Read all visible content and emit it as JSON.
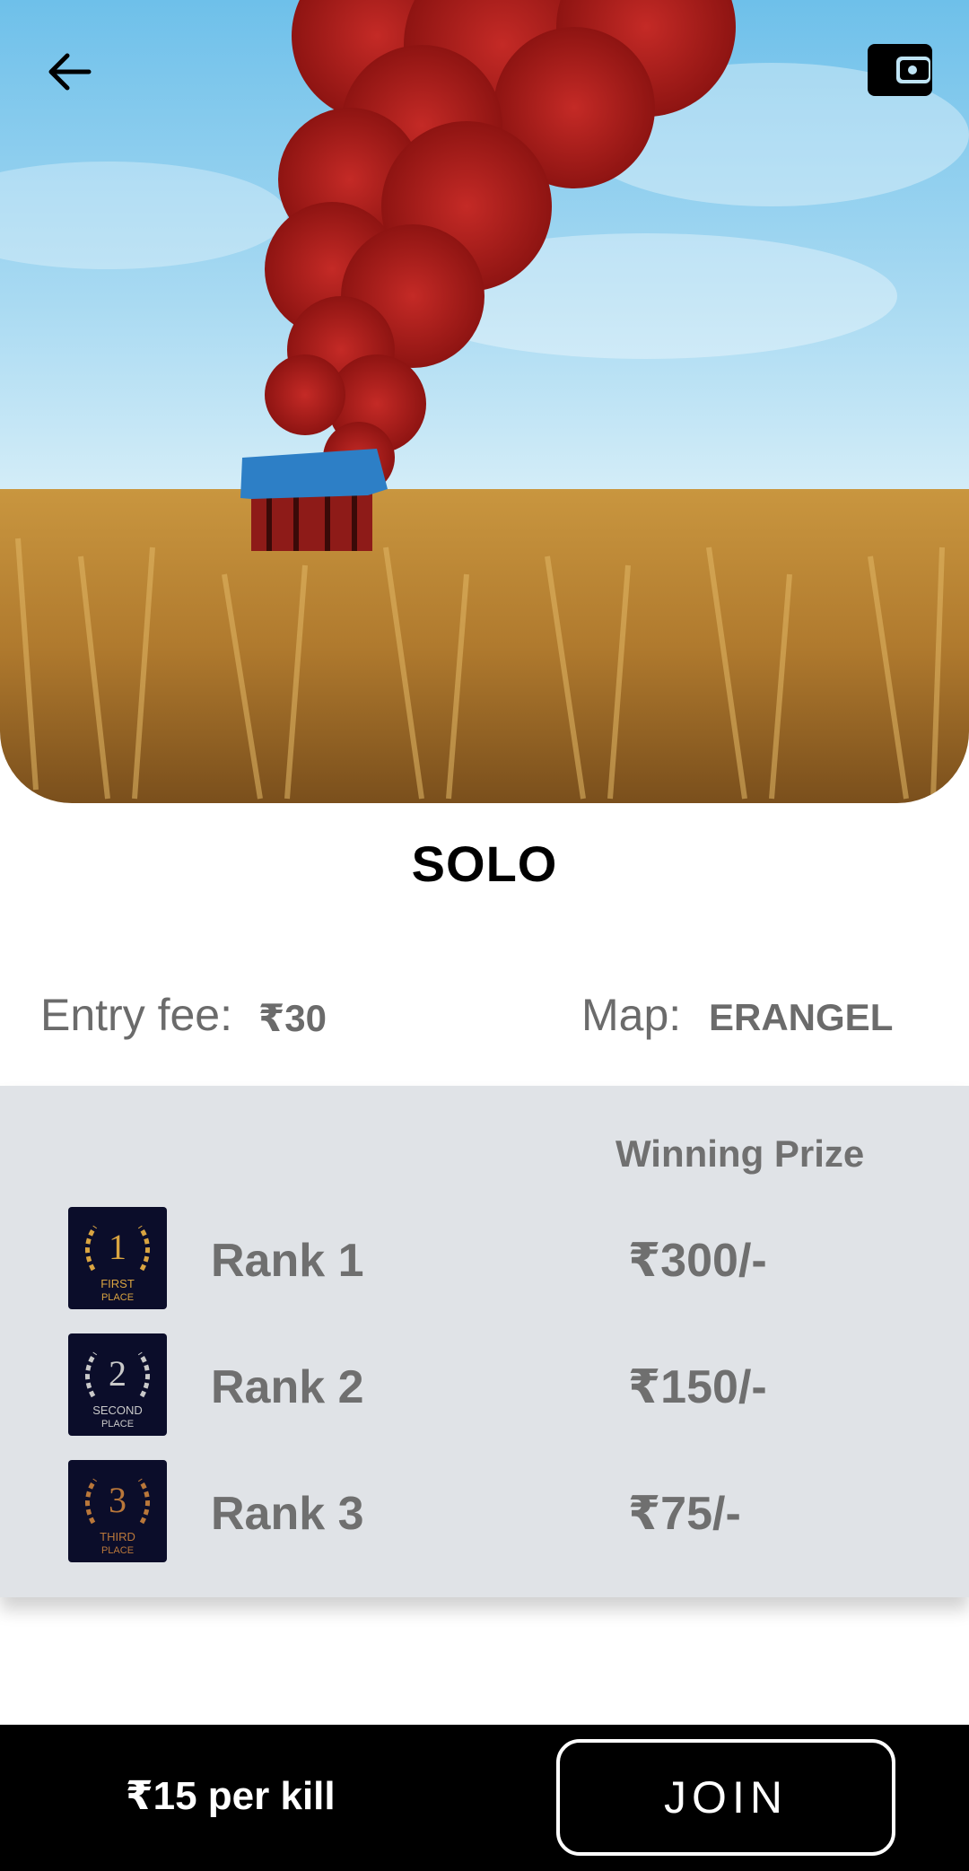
{
  "header": {
    "back_icon": "arrow-left-icon",
    "wallet_icon": "wallet-icon"
  },
  "match": {
    "title": "SOLO",
    "entry_fee_label": "Entry fee:",
    "entry_fee_value": "₹30",
    "map_label": "Map:",
    "map_value": "ERANGEL"
  },
  "prizes": {
    "header": "Winning Prize",
    "ranks": [
      {
        "label": "Rank 1",
        "prize": "₹300/-",
        "badge_number": "1",
        "badge_text_1": "FIRST",
        "badge_text_2": "PLACE",
        "badge_color": "#d9a441"
      },
      {
        "label": "Rank 2",
        "prize": "₹150/-",
        "badge_number": "2",
        "badge_text_1": "SECOND",
        "badge_text_2": "PLACE",
        "badge_color": "#c9c9c9"
      },
      {
        "label": "Rank 3",
        "prize": "₹75/-",
        "badge_number": "3",
        "badge_text_1": "THIRD",
        "badge_text_2": "PLACE",
        "badge_color": "#b9773a"
      }
    ]
  },
  "footer": {
    "per_kill": "₹15 per kill",
    "join_label": "JOIN"
  },
  "colors": {
    "title_band": "#bfe4f5",
    "card_bg": "#e0e3e7",
    "text_grey": "#6f6f6f",
    "bottom_bar": "#000000"
  }
}
